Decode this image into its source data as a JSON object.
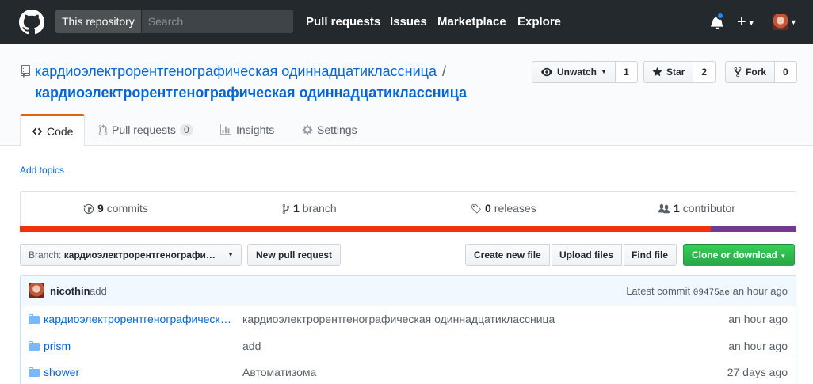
{
  "header": {
    "search_scope": "This repository",
    "search_placeholder": "Search",
    "nav": [
      "Pull requests",
      "Issues",
      "Marketplace",
      "Explore"
    ],
    "plus": "+",
    "notification_dot_color": "#2188ff"
  },
  "repo": {
    "owner": "кардиоэлектрорентгенографическая одиннадцатиклассница",
    "separator": "/",
    "name": "кардиоэлектрорентгенографическая одиннадцатиклассница",
    "actions": {
      "watch": {
        "label": "Unwatch",
        "count": "1"
      },
      "star": {
        "label": "Star",
        "count": "2"
      },
      "fork": {
        "label": "Fork",
        "count": "0"
      }
    }
  },
  "tabs": {
    "code": "Code",
    "pull_requests": "Pull requests",
    "pull_requests_count": "0",
    "insights": "Insights",
    "settings": "Settings"
  },
  "add_topics": "Add topics",
  "summary": {
    "commits_num": "9",
    "commits_label": "commits",
    "branch_num": "1",
    "branch_label": "branch",
    "releases_num": "0",
    "releases_label": "releases",
    "contributor_num": "1",
    "contributor_label": "contributor",
    "language_colors": [
      "#f1300f",
      "#6e3b8f"
    ],
    "language_shares": [
      0.89,
      0.11
    ]
  },
  "file_nav": {
    "branch_prefix": "Branch:",
    "branch_name": "кардиоэлектрорентгенографи…",
    "new_pull_request": "New pull request",
    "create_new_file": "Create new file",
    "upload_files": "Upload files",
    "find_file": "Find file",
    "clone_or_download": "Clone or download"
  },
  "latest_commit": {
    "author": "nicothin",
    "message": "add",
    "prefix": "Latest commit",
    "sha": "09475ae",
    "age": "an hour ago"
  },
  "files": [
    {
      "name": "кардиоэлектрорентгенографическая одиннадцатиклассница",
      "message": "кардиоэлектрорентгенографическая одиннадцатиклассница",
      "age": "an hour ago"
    },
    {
      "name": "prism",
      "message": "add",
      "age": "an hour ago"
    },
    {
      "name": "shower",
      "message": "Автоматизома",
      "age": "27 days ago"
    }
  ]
}
